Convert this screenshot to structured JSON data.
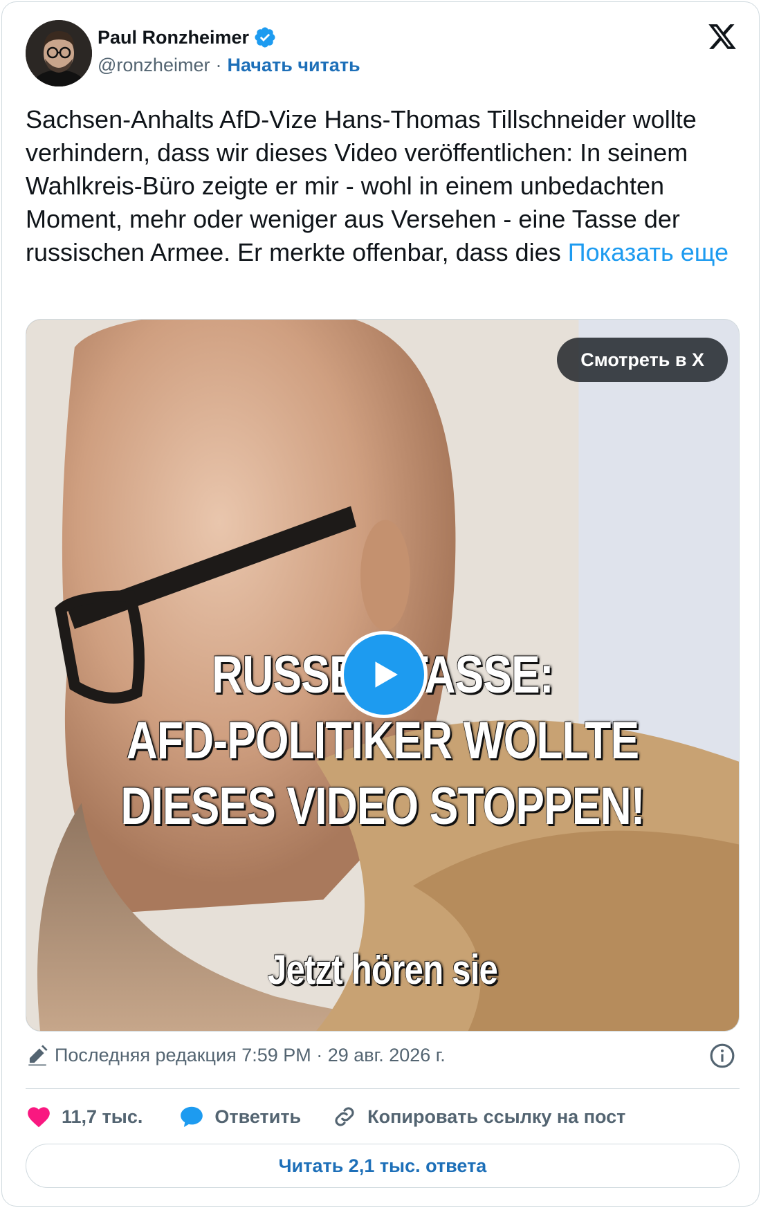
{
  "author": {
    "name": "Paul Ronzheimer",
    "handle": "@ronzheimer",
    "separator": "·",
    "follow_label": "Начать читать"
  },
  "tweet": {
    "text": "Sachsen-Anhalts AfD-Vize Hans-Thomas Tillschneider wollte verhindern, dass wir dieses Video veröffentlichen: In seinem Wahlkreis-Büro zeigte er mir - wohl in einem unbedachten Moment, mehr oder weniger aus Versehen - eine Tasse der russischen Armee. Er merkte offenbar, dass dies ",
    "show_more_label": "Показать еще"
  },
  "media": {
    "watch_label": "Смотреть в X",
    "overlay_lines": [
      "RUSSEN-TASSE:",
      "AFD-POLITIKER WOLLTE",
      "DIESES VIDEO STOPPEN!",
      "Jetzt hören sie"
    ]
  },
  "meta": {
    "edited_text": "Последняя редакция 7:59 PM · 29 авг. 2026 г."
  },
  "actions": {
    "like_count": "11,7 тыс.",
    "reply_label": "Ответить",
    "copy_link_label": "Копировать ссылку на пост"
  },
  "read_replies_label": "Читать 2,1 тыс. ответа",
  "colors": {
    "accent": "#1d9bf0",
    "link_dark": "#1d6fb8",
    "like": "#f91880",
    "muted": "#536471",
    "border": "#cfd9de"
  },
  "icons": [
    "verified-badge-icon",
    "x-logo-icon",
    "play-icon",
    "pencil-icon",
    "info-icon",
    "heart-icon",
    "reply-bubble-icon",
    "link-icon"
  ]
}
